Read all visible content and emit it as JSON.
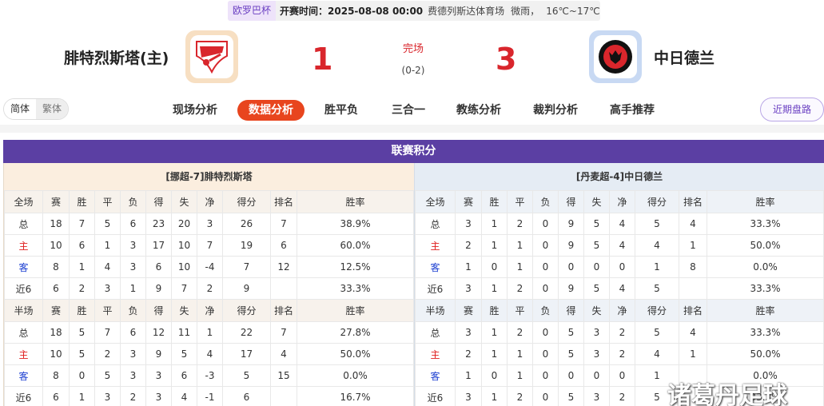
{
  "match": {
    "league": "欧罗巴杯",
    "kickoff": "开赛时间：2025-08-08 00:00",
    "venue": "费德列斯达体育场",
    "weather": "微雨，",
    "temperature": "16℃~17℃",
    "home_name": "腓特烈斯塔(主)",
    "away_name": "中日德兰",
    "home_score": "1",
    "away_score": "3",
    "status": "完场",
    "halftime": "(0-2)"
  },
  "nav": {
    "lang_simplified": "简体",
    "lang_traditional": "繁体",
    "tabs": [
      "现场分析",
      "数据分析",
      "胜平负",
      "三合一",
      "教练分析",
      "裁判分析",
      "高手推荐"
    ],
    "active_tab": "数据分析",
    "recent_button": "近期盘路"
  },
  "standings": {
    "title": "联赛积分",
    "columns": [
      "赛",
      "胜",
      "平",
      "负",
      "得",
      "失",
      "净",
      "得分",
      "排名",
      "胜率"
    ],
    "home": {
      "team_label": "[挪超-7]腓特烈斯塔",
      "full": {
        "label": "全场",
        "rows": [
          [
            "总",
            "18",
            "7",
            "5",
            "6",
            "23",
            "20",
            "3",
            "26",
            "7",
            "38.9%"
          ],
          [
            "主",
            "10",
            "6",
            "1",
            "3",
            "17",
            "10",
            "7",
            "19",
            "6",
            "60.0%"
          ],
          [
            "客",
            "8",
            "1",
            "4",
            "3",
            "6",
            "10",
            "-4",
            "7",
            "12",
            "12.5%"
          ],
          [
            "近6",
            "6",
            "2",
            "3",
            "1",
            "9",
            "7",
            "2",
            "9",
            "",
            "33.3%"
          ]
        ]
      },
      "half": {
        "label": "半场",
        "rows": [
          [
            "总",
            "18",
            "5",
            "7",
            "6",
            "12",
            "11",
            "1",
            "22",
            "7",
            "27.8%"
          ],
          [
            "主",
            "10",
            "5",
            "2",
            "3",
            "9",
            "5",
            "4",
            "17",
            "4",
            "50.0%"
          ],
          [
            "客",
            "8",
            "0",
            "5",
            "3",
            "3",
            "6",
            "-3",
            "5",
            "15",
            "0.0%"
          ],
          [
            "近6",
            "6",
            "1",
            "3",
            "2",
            "3",
            "4",
            "-1",
            "6",
            "",
            "16.7%"
          ]
        ]
      }
    },
    "away": {
      "team_label": "[丹麦超-4]中日德兰",
      "full": {
        "label": "全场",
        "rows": [
          [
            "总",
            "3",
            "1",
            "2",
            "0",
            "9",
            "5",
            "4",
            "5",
            "4",
            "33.3%"
          ],
          [
            "主",
            "2",
            "1",
            "1",
            "0",
            "9",
            "5",
            "4",
            "4",
            "1",
            "50.0%"
          ],
          [
            "客",
            "1",
            "0",
            "1",
            "0",
            "0",
            "0",
            "0",
            "1",
            "8",
            "0.0%"
          ],
          [
            "近6",
            "3",
            "1",
            "2",
            "0",
            "9",
            "5",
            "4",
            "5",
            "",
            "33.3%"
          ]
        ]
      },
      "half": {
        "label": "半场",
        "rows": [
          [
            "总",
            "3",
            "1",
            "2",
            "0",
            "5",
            "3",
            "2",
            "5",
            "4",
            "33.3%"
          ],
          [
            "主",
            "2",
            "1",
            "1",
            "0",
            "5",
            "3",
            "2",
            "4",
            "1",
            "50.0%"
          ],
          [
            "客",
            "1",
            "0",
            "1",
            "0",
            "0",
            "0",
            "0",
            "1",
            "",
            "0.0%"
          ],
          [
            "近6",
            "3",
            "1",
            "2",
            "0",
            "5",
            "3",
            "2",
            "5",
            "",
            "33.3%"
          ]
        ]
      }
    }
  },
  "watermark": "诸葛丹足球",
  "colors": {
    "accent_red": "#d9262c",
    "nav_active": "#e8451e",
    "header_purple": "#5b3fa3",
    "home_row_red": "#e02020",
    "away_row_blue": "#1c3fd1"
  }
}
